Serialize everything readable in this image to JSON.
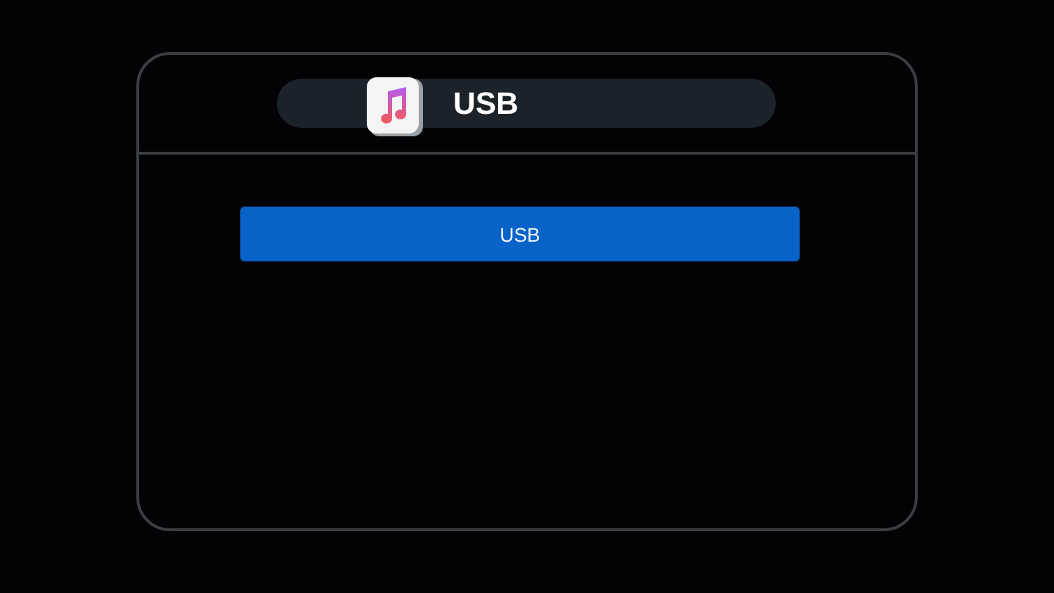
{
  "header": {
    "title": "USB"
  },
  "options": [
    {
      "label": "USB"
    }
  ]
}
